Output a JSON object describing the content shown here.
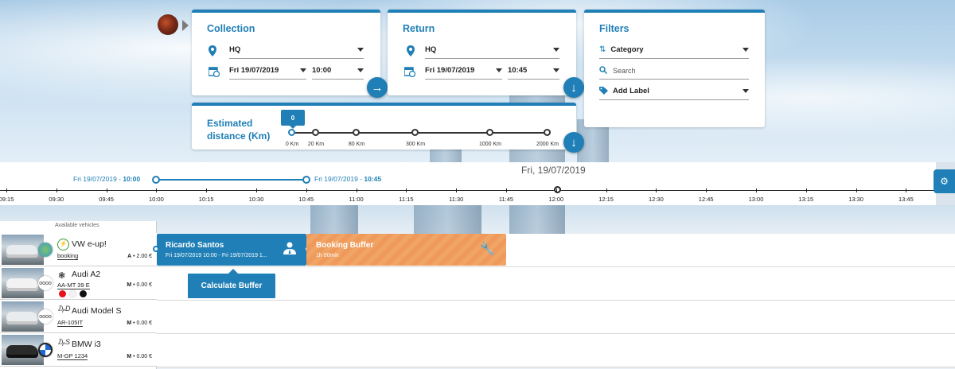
{
  "collection": {
    "title": "Collection",
    "location": "HQ",
    "date": "Fri 19/07/2019",
    "time": "10:00"
  },
  "return": {
    "title": "Return",
    "location": "HQ",
    "date": "Fri 19/07/2019",
    "time": "10:45"
  },
  "filters": {
    "title": "Filters",
    "category_label": "Category",
    "search_placeholder": "Search",
    "label_label": "Add Label"
  },
  "distance": {
    "title": "Estimated distance (Km)",
    "selected": "0",
    "ticks": [
      "0 Km",
      "20 Km",
      "80 Km",
      "300 Km",
      "1000 Km",
      "2000 Km"
    ]
  },
  "timeline": {
    "date_header": "Fri, 19/07/2019",
    "range_start_date": "Fri 19/07/2019 - ",
    "range_start_time": "10:00",
    "range_end_date": "Fri 19/07/2019 - ",
    "range_end_time": "10:45",
    "ticks": [
      "09:15",
      "09:30",
      "09:45",
      "10:00",
      "10:15",
      "10:30",
      "10:45",
      "11:00",
      "11:15",
      "11:30",
      "11:45",
      "12:00",
      "12:15",
      "12:30",
      "12:45",
      "13:00",
      "13:15",
      "13:30",
      "13:45"
    ]
  },
  "vehicles": {
    "header": "Available vehicles",
    "items": [
      {
        "name": "VW e-up!",
        "plate": "booking",
        "rate_class": "A",
        "rate": " • 2.00 €"
      },
      {
        "name": "Audi A2",
        "plate": "AA-MT 39 E",
        "rate_class": "M",
        "rate": " • 0.00 €"
      },
      {
        "name": "Audi Model S",
        "plate": "AR-105IT",
        "rate_class": "M",
        "rate": " • 0.00 €"
      },
      {
        "name": "BMW i3",
        "plate": "M-GP 1234",
        "rate_class": "M",
        "rate": " • 0.00 €"
      }
    ],
    "audi_a2_colors": [
      "#e8141b",
      "#f2f2f2",
      "#111111"
    ]
  },
  "booking": {
    "name": "Ricardo Santos",
    "time": "Fri 19/07/2019 10:00 - Fri 19/07/2019 1..."
  },
  "buffer": {
    "name": "Booking Buffer",
    "duration": "1h 00min"
  },
  "tooltip": {
    "label": "Calculate Buffer"
  },
  "colors": {
    "primary": "#1f7fb6",
    "buffer": "#ef9a5a"
  }
}
